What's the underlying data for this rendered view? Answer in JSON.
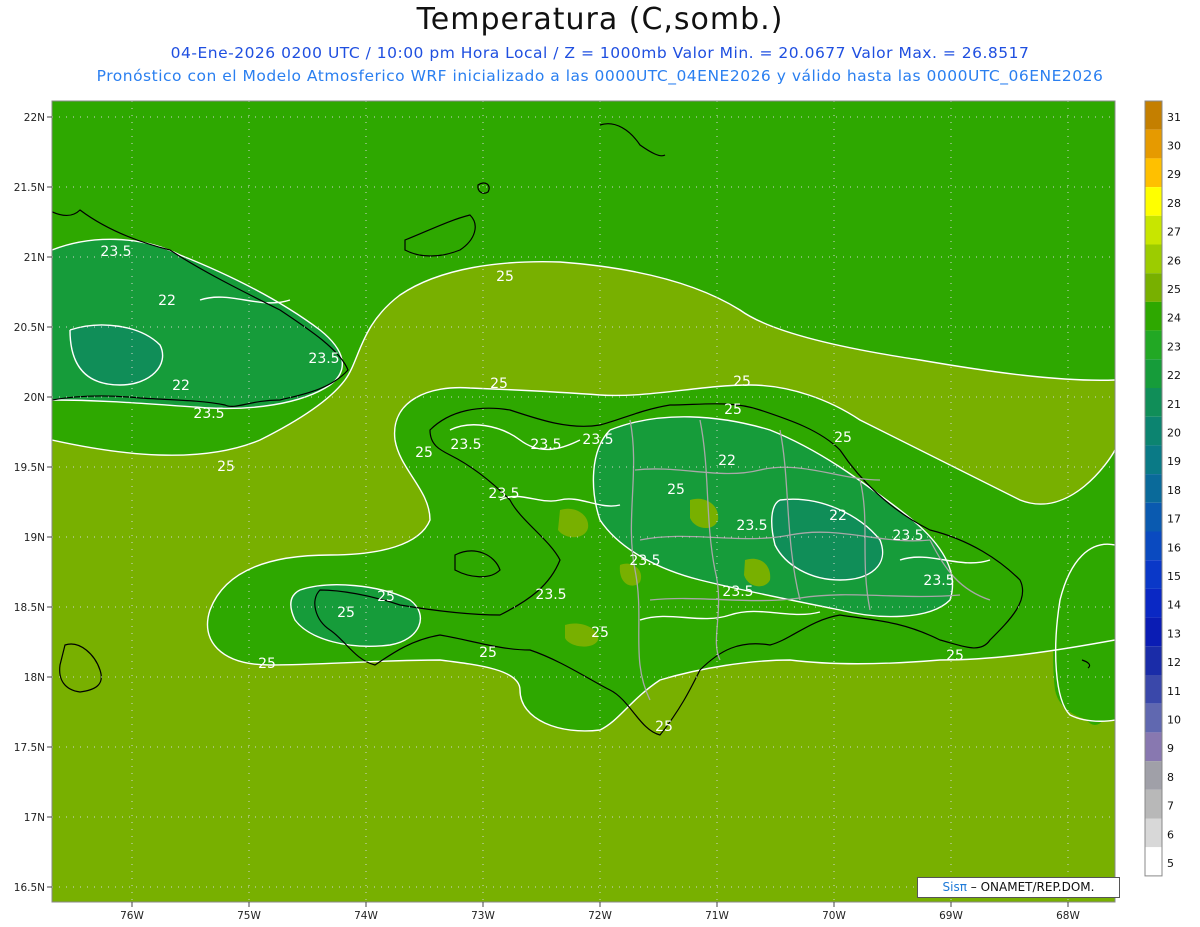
{
  "header": {
    "title": "Temperatura (C,somb.)",
    "subtitle1": "04-Ene-2026 0200 UTC / 10:00 pm Hora Local / Z = 1000mb   Valor Min. = 20.0677   Valor Max. = 26.8517",
    "subtitle2": "Pronóstico con el Modelo Atmosferico WRF inicializado a las 0000UTC_04ENE2026 y válido hasta las  0000UTC_06ENE2026"
  },
  "axes": {
    "lat_labels": [
      "22N",
      "21.5N",
      "21N",
      "20.5N",
      "20N",
      "19.5N",
      "19N",
      "18.5N",
      "18N",
      "17.5N",
      "17N",
      "16.5N"
    ],
    "lon_labels": [
      "76W",
      "75W",
      "74W",
      "73W",
      "72W",
      "71W",
      "70W",
      "69W",
      "68W"
    ]
  },
  "contour_labels": [
    {
      "text": "23.5"
    },
    {
      "text": "22"
    },
    {
      "text": "23.5"
    },
    {
      "text": "22"
    },
    {
      "text": "23.5"
    },
    {
      "text": "25"
    },
    {
      "text": "25"
    },
    {
      "text": "25"
    },
    {
      "text": "25"
    },
    {
      "text": "25"
    },
    {
      "text": "23.5"
    },
    {
      "text": "23.5"
    },
    {
      "text": "23.5"
    },
    {
      "text": "25"
    },
    {
      "text": "23.5"
    },
    {
      "text": "22"
    },
    {
      "text": "25"
    },
    {
      "text": "22"
    },
    {
      "text": "23.5"
    },
    {
      "text": "23.5"
    },
    {
      "text": "23.5"
    },
    {
      "text": "23.5"
    },
    {
      "text": "23.5"
    },
    {
      "text": "23.5"
    },
    {
      "text": "25"
    },
    {
      "text": "25"
    },
    {
      "text": "25"
    },
    {
      "text": "25"
    },
    {
      "text": "25"
    },
    {
      "text": "25"
    },
    {
      "text": "25"
    },
    {
      "text": "25"
    }
  ],
  "colorbar": {
    "labels": [
      "31",
      "30",
      "29",
      "28",
      "27",
      "26",
      "25",
      "24",
      "23",
      "22",
      "21",
      "20",
      "19",
      "18",
      "17",
      "16",
      "15",
      "14",
      "13",
      "12",
      "11",
      "10",
      "9",
      "8",
      "7",
      "6",
      "5"
    ],
    "colors": [
      "#c47f00",
      "#e69a00",
      "#ffc000",
      "#ffff00",
      "#c8e600",
      "#9ccc00",
      "#78b000",
      "#2ea800",
      "#22a824",
      "#169c3a",
      "#108e58",
      "#0c8470",
      "#0a7a86",
      "#0a6a9a",
      "#0a5ab0",
      "#0a4ac0",
      "#0a38c8",
      "#0a28c4",
      "#0a1cb4",
      "#1a2ca8",
      "#3a48aa",
      "#6068b0",
      "#8878b0",
      "#a0a0a8",
      "#b8b8b8",
      "#d8d8d8",
      "#ffffff"
    ]
  },
  "colors": {
    "land_sea_base": "#78b000",
    "cool_zone": "#2ea800",
    "cooler_zone": "#169c3a",
    "coolest_zone": "#108e58",
    "warm_patch": "#78b000"
  },
  "credit": {
    "brand": "Sisπ",
    "text": "– ONAMET/REP.DOM."
  }
}
